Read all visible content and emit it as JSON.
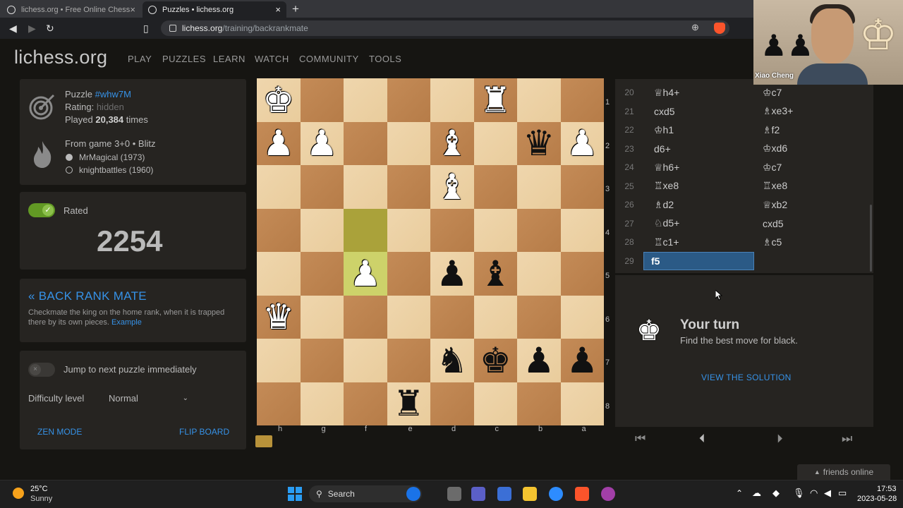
{
  "browser": {
    "tabs": [
      {
        "title": "lichess.org • Free Online Chess",
        "active": false
      },
      {
        "title": "Puzzles • lichess.org",
        "active": true
      }
    ],
    "url_host": "lichess.org",
    "url_path": "/training/backrankmate"
  },
  "header": {
    "logo": "lichess.org",
    "nav": [
      "PLAY",
      "PUZZLES",
      "LEARN",
      "WATCH",
      "COMMUNITY",
      "TOOLS"
    ]
  },
  "puzzle": {
    "label": "Puzzle",
    "id": "#whw7M",
    "rating_label": "Rating:",
    "rating_value": "hidden",
    "played_prefix": "Played",
    "played_count": "20,384",
    "played_suffix": "times",
    "from_game": "From game 3+0 • Blitz",
    "player_white": "MrMagical (1973)",
    "player_black": "knightbattles (1960)"
  },
  "rated": {
    "label": "Rated",
    "toggle_on": true,
    "rating": "2254"
  },
  "theme": {
    "title": "« BACK RANK MATE",
    "description": "Checkmate the king on the home rank, when it is trapped there by its own pieces.",
    "example_link": "Example"
  },
  "settings": {
    "jump_label": "Jump to next puzzle immediately",
    "jump_on": false,
    "difficulty_label": "Difficulty level",
    "difficulty_value": "Normal",
    "zen_mode": "ZEN MODE",
    "flip_board": "FLIP BOARD"
  },
  "board": {
    "orientation": "black",
    "files": [
      "h",
      "g",
      "f",
      "e",
      "d",
      "c",
      "b",
      "a"
    ],
    "ranks": [
      "1",
      "2",
      "3",
      "4",
      "5",
      "6",
      "7",
      "8"
    ],
    "rows": [
      [
        [
          "K",
          "w"
        ],
        null,
        null,
        null,
        null,
        [
          "R",
          "w"
        ],
        null,
        null
      ],
      [
        [
          "P",
          "w"
        ],
        [
          "P",
          "w"
        ],
        null,
        null,
        [
          "B",
          "w"
        ],
        null,
        [
          "Q",
          "b"
        ],
        [
          "P",
          "w"
        ]
      ],
      [
        null,
        null,
        null,
        null,
        [
          "B",
          "w"
        ],
        null,
        null,
        null
      ],
      [
        null,
        null,
        null,
        null,
        null,
        null,
        null,
        null
      ],
      [
        null,
        null,
        [
          "P",
          "w"
        ],
        null,
        [
          "P",
          "b"
        ],
        [
          "B",
          "b"
        ],
        null,
        null
      ],
      [
        [
          "Q",
          "w"
        ],
        null,
        null,
        null,
        null,
        null,
        null,
        null
      ],
      [
        null,
        null,
        null,
        null,
        [
          "N",
          "b"
        ],
        [
          "K",
          "b"
        ],
        [
          "P",
          "b"
        ],
        [
          "P",
          "b"
        ]
      ],
      [
        null,
        null,
        null,
        [
          "R",
          "b"
        ],
        null,
        null,
        null,
        null
      ]
    ],
    "last_move_from": "f4",
    "last_move_to": "f5"
  },
  "moves": [
    {
      "n": "20",
      "w": "♕h4+",
      "b": "♔c7"
    },
    {
      "n": "21",
      "w": "cxd5",
      "b": "♗xe3+"
    },
    {
      "n": "22",
      "w": "♔h1",
      "b": "♗f2"
    },
    {
      "n": "23",
      "w": "d6+",
      "b": "♔xd6"
    },
    {
      "n": "24",
      "w": "♕h6+",
      "b": "♔c7"
    },
    {
      "n": "25",
      "w": "♖xe8",
      "b": "♖xe8"
    },
    {
      "n": "26",
      "w": "♗d2",
      "b": "♕xb2"
    },
    {
      "n": "27",
      "w": "♘d5+",
      "b": "cxd5"
    },
    {
      "n": "28",
      "w": "♖c1+",
      "b": "♗c5"
    },
    {
      "n": "29",
      "w": "f5",
      "b": ""
    }
  ],
  "turn": {
    "title": "Your turn",
    "subtitle": "Find the best move for black.",
    "solution": "VIEW THE SOLUTION"
  },
  "webcam": {
    "name": "Xiao Cheng"
  },
  "friends": "friends online",
  "taskbar": {
    "temp": "25°C",
    "weather": "Sunny",
    "search": "Search",
    "time": "17:53",
    "date": "2023-05-28"
  },
  "colors": {
    "accent": "#3692e7",
    "toggle_green": "#629924",
    "selected_move": "#2b5a86"
  }
}
